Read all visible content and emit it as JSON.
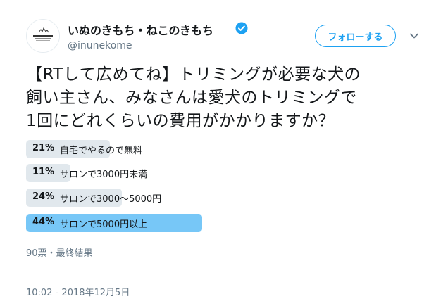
{
  "author": {
    "display_name": "いぬのきもち・ねこのきもち",
    "handle": "@inunekome",
    "verified": true,
    "avatar_icon": "brand-logo-avatar",
    "avatar_text": "いぬのきもち ねこのきもち"
  },
  "follow_button": {
    "label": "フォローする"
  },
  "tweet": {
    "text_lines": [
      "【RTして広めてね】トリミングが必要な犬の",
      "飼い主さん、みなさんは愛犬のトリミングで",
      "1回にどれくらいの費用がかかりますか？"
    ]
  },
  "poll": {
    "options": [
      {
        "percent_label": "21%",
        "percent": 21,
        "label": "自宅でやるので無料",
        "winner": false
      },
      {
        "percent_label": "11%",
        "percent": 11,
        "label": "サロンで3000円未満",
        "winner": false
      },
      {
        "percent_label": "24%",
        "percent": 24,
        "label": "サロンで3000～5000円",
        "winner": false
      },
      {
        "percent_label": "44%",
        "percent": 44,
        "label": "サロンで5000円以上",
        "winner": true
      }
    ],
    "meta": "90票・最終結果"
  },
  "timestamp": "10:02 - 2018年12月5日",
  "colors": {
    "accent": "#1da1f2",
    "bar": "#e1e8ed",
    "winner_bar": "#77c7f7",
    "secondary_text": "#657786"
  }
}
